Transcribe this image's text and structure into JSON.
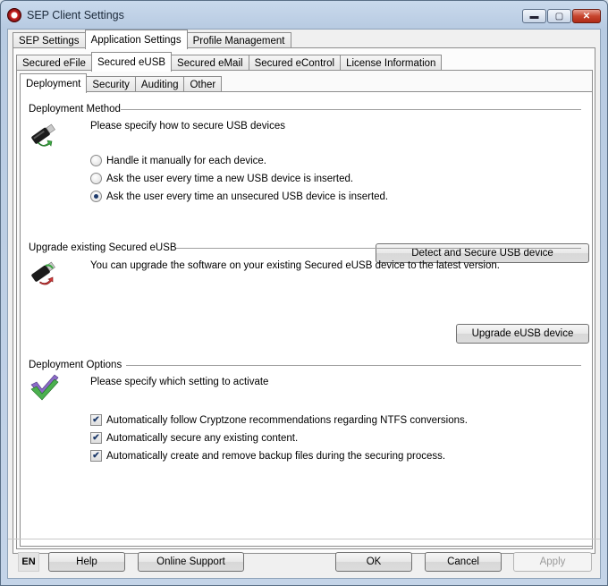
{
  "window": {
    "title": "SEP Client Settings",
    "min_glyph": "▬",
    "max_glyph": "▢",
    "close_glyph": "✕"
  },
  "tabs_level1": [
    "SEP Settings",
    "Application Settings",
    "Profile Management"
  ],
  "tabs_level2": [
    "Secured eFile",
    "Secured eUSB",
    "Secured eMail",
    "Secured eControl",
    "License Information"
  ],
  "tabs_level3": [
    "Deployment",
    "Security",
    "Auditing",
    "Other"
  ],
  "deployment_method": {
    "title": "Deployment Method",
    "description": "Please specify how to secure USB devices",
    "options": [
      "Handle it manually for each device.",
      "Ask the user every time a new USB device is inserted.",
      "Ask the user every time an unsecured USB device is inserted."
    ],
    "selected_index": 2,
    "button": "Detect and Secure USB device"
  },
  "upgrade": {
    "title": "Upgrade existing Secured eUSB",
    "description": "You can upgrade the software on your existing Secured eUSB device to the latest version.",
    "button": "Upgrade eUSB device"
  },
  "options": {
    "title": "Deployment Options",
    "description": "Please specify which setting to activate",
    "checkboxes": [
      {
        "label": "Automatically follow Cryptzone recommendations regarding NTFS conversions.",
        "checked": true
      },
      {
        "label": "Automatically secure any existing content.",
        "checked": true
      },
      {
        "label": "Automatically create and remove backup files during the securing process.",
        "checked": true
      }
    ]
  },
  "footer": {
    "language": "EN",
    "help": "Help",
    "online_support": "Online Support",
    "ok": "OK",
    "cancel": "Cancel",
    "apply": "Apply"
  },
  "icons": {
    "usb_secure": "usb-stick-green-arrow-icon",
    "usb_upgrade": "usb-stick-red-arrow-icon",
    "check": "green-purple-checkmark-icon"
  }
}
